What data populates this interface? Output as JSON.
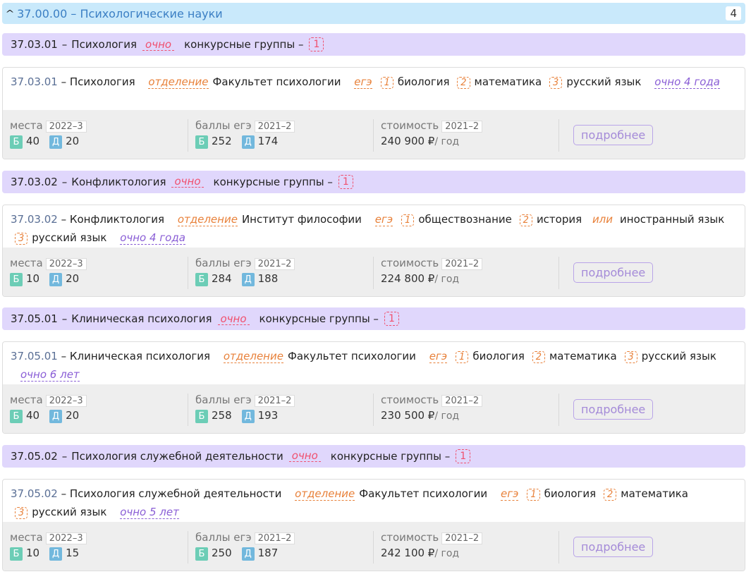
{
  "header": {
    "title": "37.00.00 – Психологические науки",
    "count": "4"
  },
  "labels": {
    "ochno": "очно",
    "groups": "конкурсные группы –",
    "department": "отделение",
    "ege": "егэ",
    "or": "или",
    "places": "места",
    "scores": "баллы егэ",
    "cost": "стоимость",
    "more": "подробнее",
    "budget": "Б",
    "paid": "Д",
    "per_year": "/ год"
  },
  "programs": [
    {
      "code": "37.03.01",
      "name": "Психология",
      "groups": "1",
      "dept": "Факультет психологии",
      "subjects": [
        [
          "биология"
        ],
        [
          "математика"
        ],
        [
          "русский язык"
        ]
      ],
      "duration": "очно  4 года",
      "places_year": "2022–3",
      "places_b": "40",
      "places_d": "20",
      "scores_year": "2021–2",
      "scores_b": "252",
      "scores_d": "174",
      "cost_year": "2021–2",
      "cost": "240 900 ₽"
    },
    {
      "code": "37.03.02",
      "name": "Конфликтология",
      "groups": "1",
      "dept": "Институт философии",
      "subjects": [
        [
          "обществознание"
        ],
        [
          "история",
          "иностранный язык"
        ],
        [
          "русский язык"
        ]
      ],
      "duration": "очно  4 года",
      "places_year": "2022–3",
      "places_b": "10",
      "places_d": "20",
      "scores_year": "2021–2",
      "scores_b": "284",
      "scores_d": "188",
      "cost_year": "2021–2",
      "cost": "224 800 ₽"
    },
    {
      "code": "37.05.01",
      "name": "Клиническая психология",
      "groups": "1",
      "dept": "Факультет психологии",
      "subjects": [
        [
          "биология"
        ],
        [
          "математика"
        ],
        [
          "русский язык"
        ]
      ],
      "duration": "очно  6 лет",
      "places_year": "2022–3",
      "places_b": "40",
      "places_d": "20",
      "scores_year": "2021–2",
      "scores_b": "258",
      "scores_d": "193",
      "cost_year": "2021–2",
      "cost": "230 500 ₽"
    },
    {
      "code": "37.05.02",
      "name": "Психология служебной деятельности",
      "groups": "1",
      "dept": "Факультет психологии",
      "subjects": [
        [
          "биология"
        ],
        [
          "математика"
        ],
        [
          "русский язык"
        ]
      ],
      "duration": "очно  5 лет",
      "places_year": "2022–3",
      "places_b": "10",
      "places_d": "15",
      "scores_year": "2021–2",
      "scores_b": "250",
      "scores_d": "187",
      "cost_year": "2021–2",
      "cost": "242 100 ₽"
    }
  ]
}
